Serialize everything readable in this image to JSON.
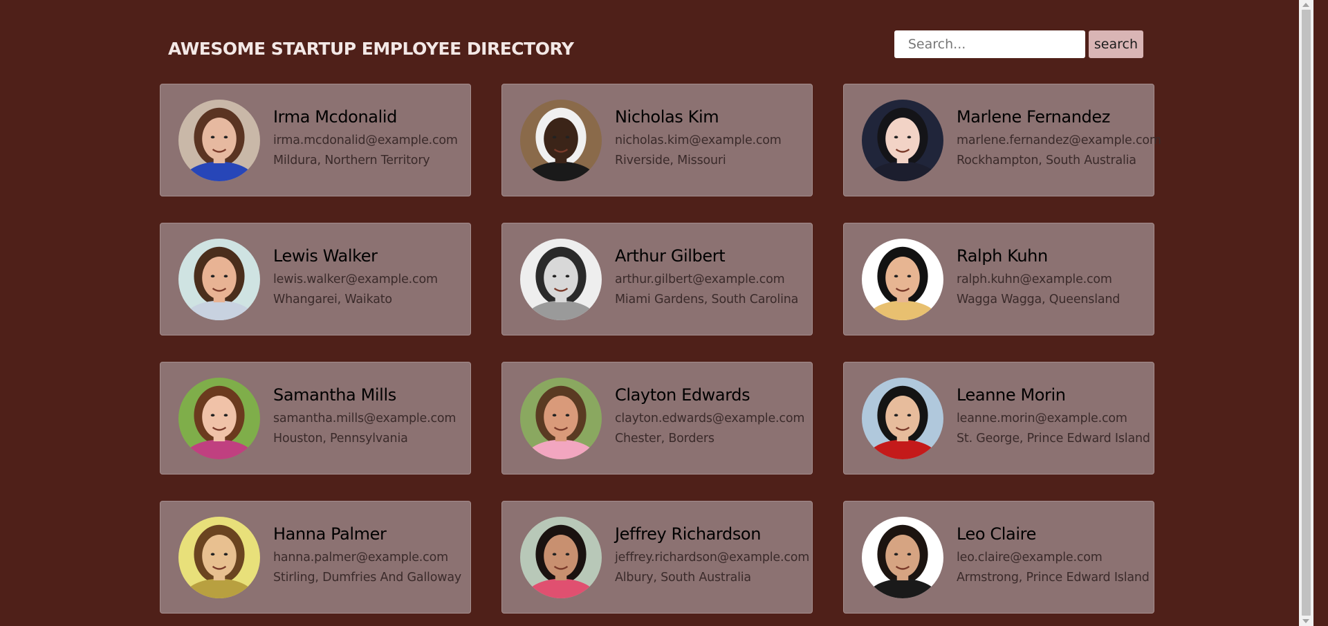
{
  "header": {
    "title": "AWESOME STARTUP EMPLOYEE DIRECTORY"
  },
  "search": {
    "placeholder": "Search...",
    "value": "",
    "button_label": "search"
  },
  "employees": [
    {
      "name": "Irma Mcdonalid",
      "email": "irma.mcdonalid@example.com",
      "location": "Mildura, Northern Territory",
      "skin": "#e6b9a0",
      "hair": "#5a3422",
      "shirt": "#2746b8",
      "bg": "#c9b8a8"
    },
    {
      "name": "Nicholas Kim",
      "email": "nicholas.kim@example.com",
      "location": "Riverside, Missouri",
      "skin": "#3b2418",
      "hair": "#f0f0f0",
      "shirt": "#1a1a1a",
      "bg": "#8a6a4a"
    },
    {
      "name": "Marlene Fernandez",
      "email": "marlene.fernandez@example.com",
      "location": "Rockhampton, South Australia",
      "skin": "#f2d3c6",
      "hair": "#141418",
      "shirt": "#1c1e2e",
      "bg": "#20253a"
    },
    {
      "name": "Lewis Walker",
      "email": "lewis.walker@example.com",
      "location": "Whangarei, Waikato",
      "skin": "#e8b394",
      "hair": "#4a2e1c",
      "shirt": "#c8d2e0",
      "bg": "#cfe3e2"
    },
    {
      "name": "Arthur Gilbert",
      "email": "arthur.gilbert@example.com",
      "location": "Miami Gardens, South Carolina",
      "skin": "#d8d8d8",
      "hair": "#2a2a2a",
      "shirt": "#9a9a9a",
      "bg": "#eeeeee"
    },
    {
      "name": "Ralph Kuhn",
      "email": "ralph.kuhn@example.com",
      "location": "Wagga Wagga, Queensland",
      "skin": "#e7b592",
      "hair": "#121212",
      "shirt": "#e8c070",
      "bg": "#ffffff"
    },
    {
      "name": "Samantha Mills",
      "email": "samantha.mills@example.com",
      "location": "Houston, Pennsylvania",
      "skin": "#f0c2a8",
      "hair": "#6b3a1e",
      "shirt": "#c04080",
      "bg": "#7fae4a"
    },
    {
      "name": "Clayton Edwards",
      "email": "clayton.edwards@example.com",
      "location": "Chester, Borders",
      "skin": "#d99a7a",
      "hair": "#5a3a22",
      "shirt": "#f2a6c0",
      "bg": "#8aa860"
    },
    {
      "name": "Leanne Morin",
      "email": "leanne.morin@example.com",
      "location": "St. George, Prince Edward Island",
      "skin": "#e7bc9c",
      "hair": "#141414",
      "shirt": "#c41a1a",
      "bg": "#b0c8dc"
    },
    {
      "name": "Hanna Palmer",
      "email": "hanna.palmer@example.com",
      "location": "Stirling, Dumfries And Galloway",
      "skin": "#e8c090",
      "hair": "#6a4420",
      "shirt": "#b8a040",
      "bg": "#e8e07a"
    },
    {
      "name": "Jeffrey Richardson",
      "email": "jeffrey.richardson@example.com",
      "location": "Albury, South Australia",
      "skin": "#c89070",
      "hair": "#1a1210",
      "shirt": "#e05070",
      "bg": "#b8c8b8"
    },
    {
      "name": "Leo Claire",
      "email": "leo.claire@example.com",
      "location": "Armstrong, Prince Edward Island",
      "skin": "#d6a482",
      "hair": "#1c1410",
      "shirt": "#1a1a1a",
      "bg": "#ffffff"
    }
  ]
}
